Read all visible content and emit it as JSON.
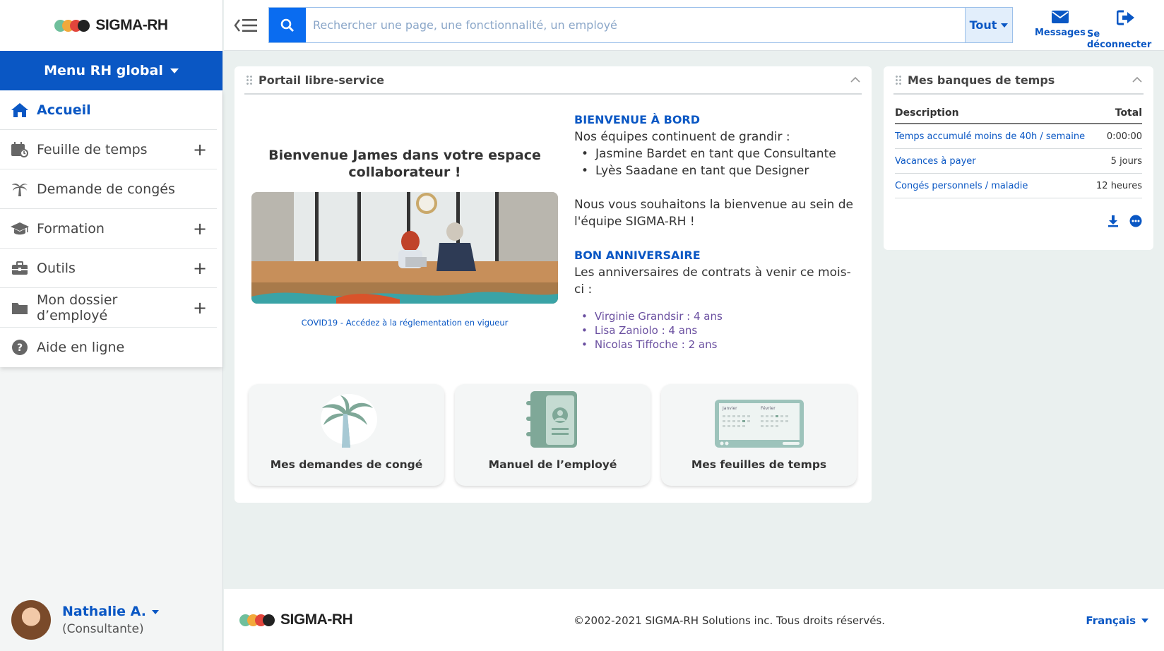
{
  "brand": {
    "name": "SIGMA-RH",
    "dot_colors": [
      "#6fbf9c",
      "#f2a93b",
      "#e2453c",
      "#222222"
    ],
    "accent": "#0a57c4"
  },
  "sidebar": {
    "menu_label": "Menu RH global",
    "items": [
      {
        "label": "Accueil",
        "icon": "home-icon",
        "expandable": false,
        "active": true
      },
      {
        "label": "Feuille de temps",
        "icon": "calendar-clock-icon",
        "expandable": true
      },
      {
        "label": "Demande de congés",
        "icon": "palm-tree-icon",
        "expandable": false
      },
      {
        "label": "Formation",
        "icon": "graduation-cap-icon",
        "expandable": true
      },
      {
        "label": "Outils",
        "icon": "toolbox-icon",
        "expandable": true
      },
      {
        "label": "Mon dossier d’employé",
        "icon": "folder-icon",
        "expandable": true
      },
      {
        "label": "Aide en ligne",
        "icon": "help-circle-icon",
        "expandable": false
      }
    ],
    "user": {
      "name": "Nathalie A.",
      "role": "(Consultante)"
    }
  },
  "topbar": {
    "search_placeholder": "Rechercher une page, une fonctionnalité, un employé",
    "search_scope": "Tout",
    "messages_label": "Messages",
    "logout_label": "Se déconnecter"
  },
  "portal": {
    "title": "Portail libre-service",
    "welcome": "Bienvenue James dans votre espace collaborateur !",
    "covid_link": "COVID19 - Accédez à la réglementation en vigueur",
    "onboarding_heading": "BIENVENUE À BORD",
    "onboarding_intro": "Nos équipes continuent de grandir :",
    "new_hires": [
      "Jasmine Bardet en tant que Consultante",
      "Lyès Saadane en tant que Designer"
    ],
    "onboarding_outro": "Nous vous souhaitons la bienvenue au sein de l'équipe SIGMA-RH !",
    "birthday_heading": "BON ANNIVERSAIRE",
    "birthday_intro": "Les anniversaires de contrats à venir ce mois-ci :",
    "anniversaries": [
      "Virginie Grandsir : 4 ans",
      "Lisa Zaniolo : 4 ans",
      "Nicolas Tiffoche : 2 ans"
    ],
    "tiles": [
      {
        "label": "Mes demandes de congé",
        "icon": "palm-tree-icon"
      },
      {
        "label": "Manuel de l’employé",
        "icon": "address-book-icon"
      },
      {
        "label": "Mes feuilles de temps",
        "icon": "calendar-board-icon"
      }
    ],
    "calendar_months": [
      "Janvier",
      "Février"
    ]
  },
  "banks": {
    "title": "Mes banques de temps",
    "col_description": "Description",
    "col_total": "Total",
    "rows": [
      {
        "description": "Temps accumulé moins de 40h / semaine",
        "total": "0:00:00"
      },
      {
        "description": "Vacances à payer",
        "total": "5 jours"
      },
      {
        "description": "Congés personnels / maladie",
        "total": "12 heures"
      }
    ]
  },
  "footer": {
    "copyright": "©2002-2021 SIGMA-RH Solutions inc. Tous droits réservés.",
    "language": "Français"
  }
}
